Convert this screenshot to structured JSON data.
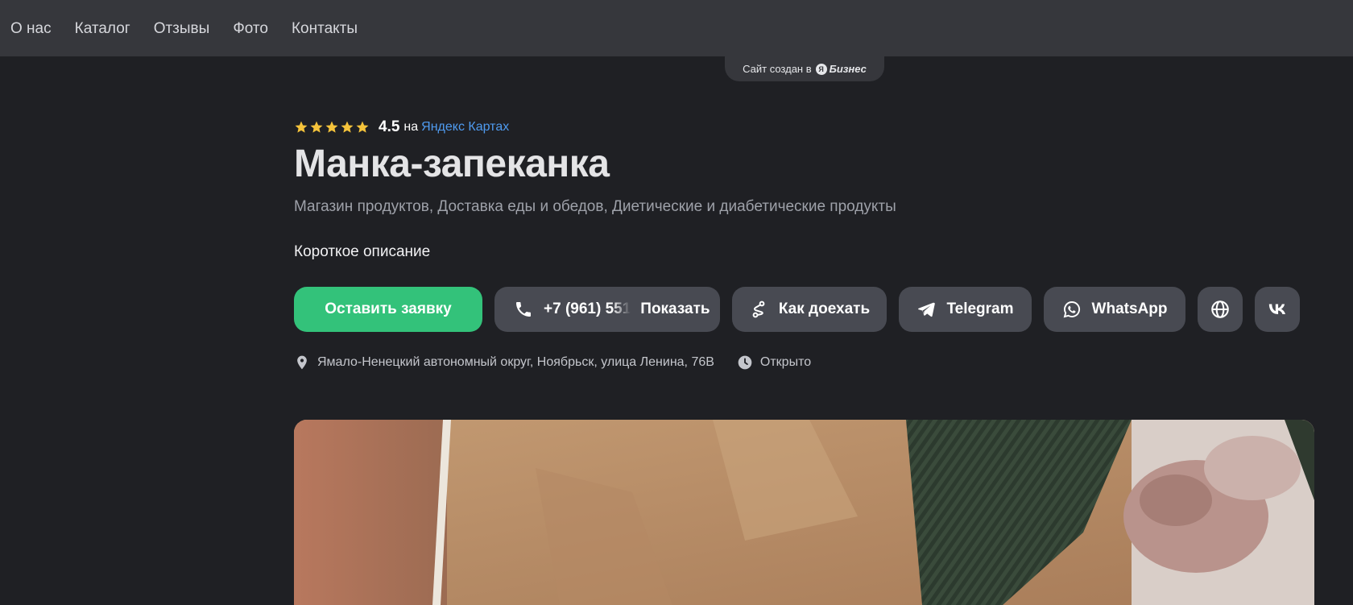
{
  "nav": {
    "items": [
      {
        "label": "О нас"
      },
      {
        "label": "Каталог"
      },
      {
        "label": "Отзывы"
      },
      {
        "label": "Фото"
      },
      {
        "label": "Контакты"
      }
    ]
  },
  "badge": {
    "prefix": "Сайт создан в",
    "logo_letter": "Я",
    "brand": "Бизнес"
  },
  "rating": {
    "stars": 5,
    "value": "4.5",
    "on": "на",
    "link_label": "Яндекс Картах",
    "star_color": "#f5c33b"
  },
  "company": {
    "name": "Манка-запеканка",
    "categories": "Магазин продуктов, Доставка еды и обедов, Диетические и диабетические продукты",
    "short_description": "Короткое описание"
  },
  "actions": {
    "request_label": "Оставить заявку",
    "phone_partial": "+7 (961) 551",
    "show_label": "Показать",
    "route_label": "Как доехать",
    "telegram_label": "Telegram",
    "whatsapp_label": "WhatsApp",
    "globe_icon": "globe-icon",
    "vk_icon": "vk-icon",
    "primary_color": "#33c27a"
  },
  "info": {
    "address": "Ямало-Ненецкий автономный округ, Ноябрьск, улица Ленина, 76В",
    "hours_status": "Открыто"
  }
}
